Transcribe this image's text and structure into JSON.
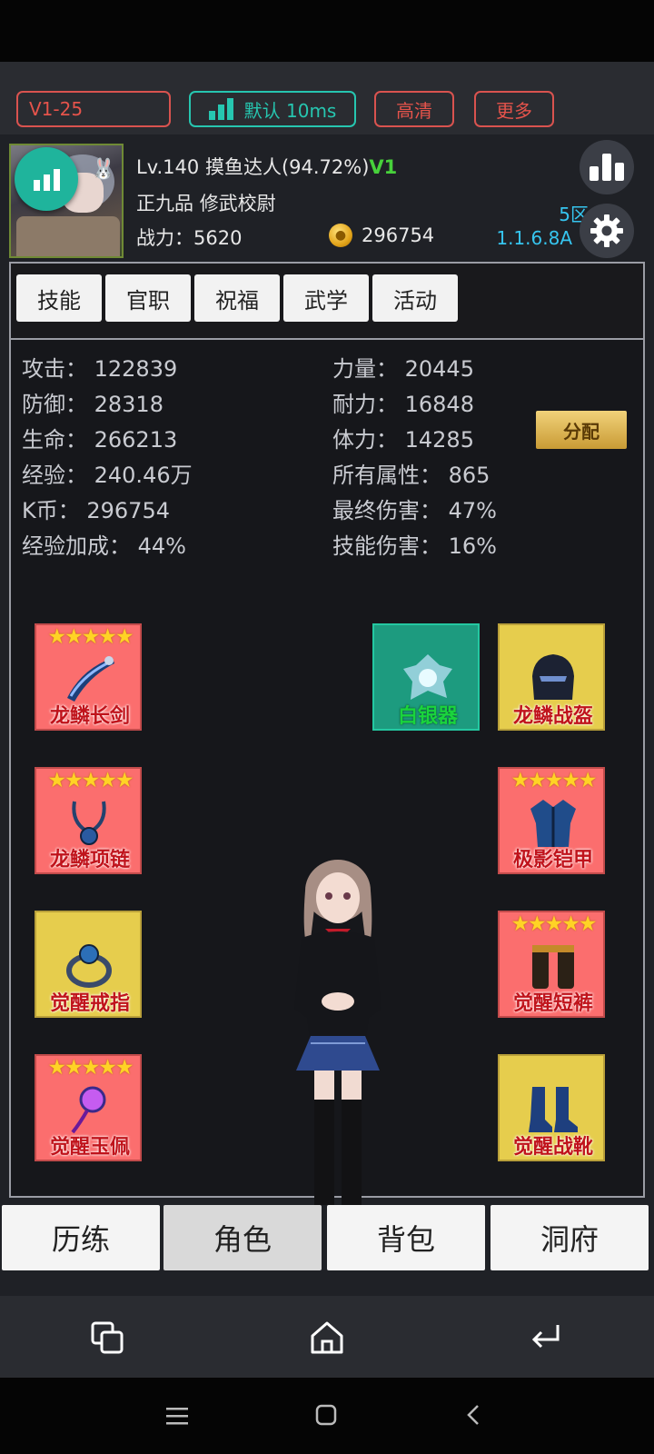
{
  "stream_toolbar": {
    "quality_level": "V1-25",
    "network": "默认 10ms",
    "hd_button": "高清",
    "more_button": "更多"
  },
  "player": {
    "level": "Lv.140",
    "name": "摸鱼达人",
    "exp_percent": "(94.72%)",
    "vip": "V1",
    "rank": "正九品",
    "title": "修武校尉",
    "power_label": "战力：",
    "power_value": "5620",
    "gold": "296754",
    "zone": "5区",
    "version": "1.1.6.8A"
  },
  "tabs": [
    "技能",
    "官职",
    "祝福",
    "武学",
    "活动"
  ],
  "stats": {
    "attack": "攻击：  122839",
    "defense": "防御：  28318",
    "life": "生命：  266213",
    "exp": "经验：  240.46万",
    "kcoin": "K币：  296754",
    "exp_bonus": "经验加成：  44%",
    "strength": "力量：  20445",
    "endurance": "耐力：  16848",
    "stamina": "体力：  14285",
    "all_attr": "所有属性：  865",
    "final_damage": "最终伤害：  47%",
    "skill_damage": "技能伤害：  16%"
  },
  "allocate_button": "分配",
  "equipment": {
    "sword": {
      "name": "龙鳞长剑",
      "stars": "★★★★★"
    },
    "necklace": {
      "name": "龙鳞项链",
      "stars": "★★★★★"
    },
    "ring": {
      "name": "觉醒戒指",
      "stars": ""
    },
    "pendant": {
      "name": "觉醒玉佩",
      "stars": "★★★★★"
    },
    "weapon_artifact": {
      "name": "白银器",
      "stars": ""
    },
    "helmet": {
      "name": "龙鳞战盔",
      "stars": ""
    },
    "armor": {
      "name": "极影铠甲",
      "stars": "★★★★★"
    },
    "pants": {
      "name": "觉醒短裤",
      "stars": "★★★★★"
    },
    "boots": {
      "name": "觉醒战靴",
      "stars": ""
    }
  },
  "bottom_tabs": [
    "历练",
    "角色",
    "背包",
    "洞府"
  ],
  "active_bottom_tab": "角色",
  "colors": {
    "red_slot": "#fb6e6e",
    "yellow_slot": "#e6cd4d",
    "green_slot": "#1d9b7f",
    "accent_teal": "#26c6b0",
    "zone_blue": "#36c5ef",
    "vip_green": "#47d13b"
  }
}
